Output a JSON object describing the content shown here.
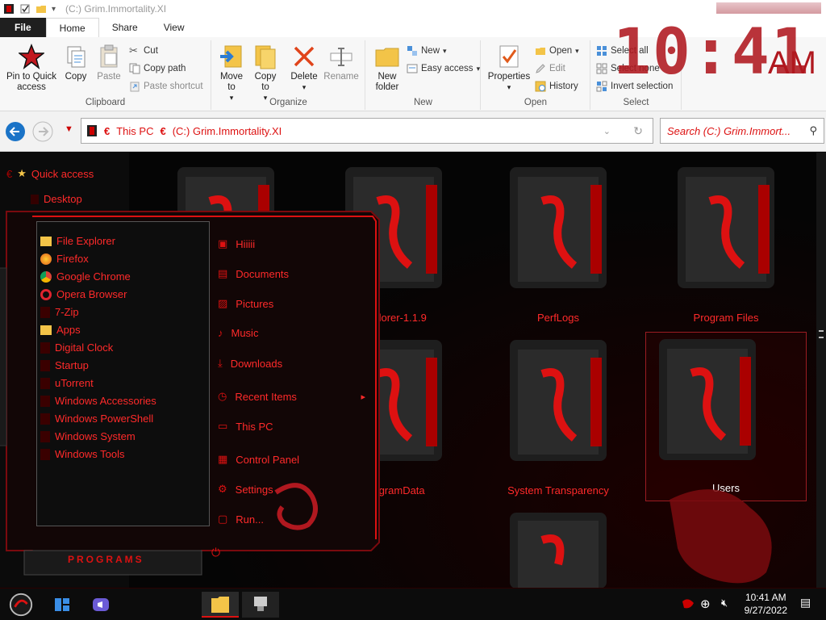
{
  "titlebar": {
    "title": "(C:) Grim.Immortality.XI"
  },
  "tabs": [
    "File",
    "Home",
    "Share",
    "View"
  ],
  "ribbon": {
    "clipboard": {
      "label": "Clipboard",
      "pin": "Pin to Quick access",
      "copy": "Copy",
      "paste": "Paste",
      "cut": "Cut",
      "copy_path": "Copy path",
      "paste_shortcut": "Paste shortcut"
    },
    "organize": {
      "label": "Organize",
      "move_to": "Move to",
      "copy_to": "Copy to",
      "delete": "Delete",
      "rename": "Rename"
    },
    "new": {
      "label": "New",
      "new_folder": "New folder",
      "new_item": "New",
      "easy_access": "Easy access"
    },
    "open": {
      "label": "Open",
      "properties": "Properties",
      "open": "Open",
      "edit": "Edit",
      "history": "History"
    },
    "select": {
      "label": "Select",
      "select_all": "Select all",
      "select_none": "Select none",
      "invert": "Invert selection"
    }
  },
  "clock": {
    "digits": "10:41",
    "ampm": "AM"
  },
  "address": {
    "crumb1": "This PC",
    "crumb2": "(C:) Grim.Immortality.XI",
    "search_placeholder": "Search (C:) Grim.Immort..."
  },
  "navpane": {
    "quick_access": "Quick access",
    "desktop": "Desktop"
  },
  "folders": {
    "f2": "Explorer-1.1.9",
    "f3": "PerfLogs",
    "f4": "Program Files",
    "f5": "ProgramData",
    "f6": "System Transparency",
    "f7": "Users"
  },
  "startmenu": {
    "programs": [
      "File Explorer",
      "Firefox",
      "Google Chrome",
      "Opera Browser",
      "7-Zip",
      "Apps",
      "Digital Clock",
      "Startup",
      "uTorrent",
      "Windows Accessories",
      "Windows PowerShell",
      "Windows System",
      "Windows Tools"
    ],
    "links": [
      "Hiiiii",
      "Documents",
      "Pictures",
      "Music",
      "Downloads",
      "Recent Items",
      "This PC",
      "Control Panel",
      "Settings",
      "Run..."
    ],
    "programs_label": "PROGRAMS"
  },
  "taskbar": {
    "time": "10:41 AM",
    "date": "9/27/2022"
  },
  "colors": {
    "accent": "#ff2a2a",
    "dark_red": "#b0181f",
    "bg": "#050505"
  }
}
